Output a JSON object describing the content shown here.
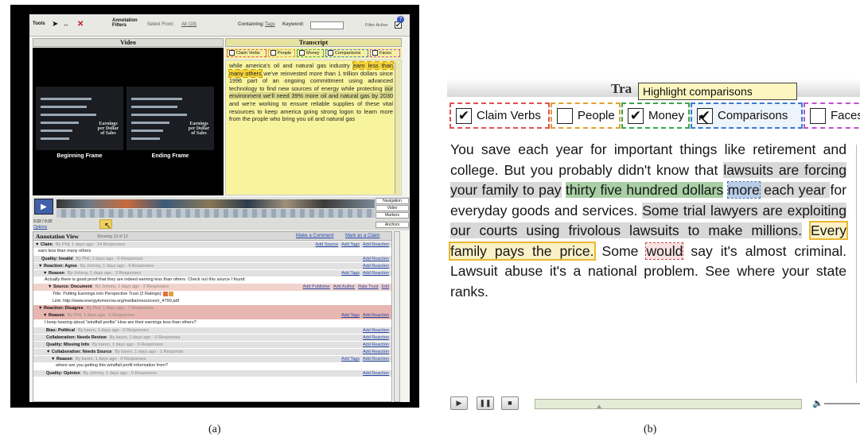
{
  "panel_a": {
    "toolbar": {
      "tools_label": "Tools",
      "annotation_filters_label": "Annotation Filters",
      "select_from_label": "Select From:",
      "select_from_value": "All (19)",
      "containing_label": "Containing:",
      "containing_value": "Tags",
      "keyword_label": "Keyword:",
      "keyword_value": "",
      "filter_active_label": "Filter Active",
      "filter_active_checked": "✔"
    },
    "video": {
      "title": "Video",
      "beginning_frame_label": "Beginning Frame",
      "ending_frame_label": "Ending Frame",
      "frame_overlay_text": "Earnings per Dollar of Sales"
    },
    "transcript": {
      "title": "Transcript",
      "categories": [
        "Claim Verbs",
        "People",
        "Money",
        "Comparisons",
        "Faces"
      ],
      "text_pre": "while america's oil and natural gas industry ",
      "text_hl1": "earn less than many others",
      "text_mid": " we've reinvested more than 1 trillion dollars since 1996 part of an ongoing committment using advanced technology to find new sources of energy while protecting ",
      "text_hl2": "our environment we'll need 39% more oil and natural gas by 2030",
      "text_post": " and we're working to ensure reliable supplies of these vital resources to keep america going strong logon to learn more from the prople who bring you oil and natural gas"
    },
    "timeline": {
      "time": "0:32 / 0:32",
      "options": "Options",
      "navigation": "Navigation",
      "video": "Video",
      "markers": "Markers",
      "anchors": "Anchors"
    },
    "annotation_view": {
      "title": "Annotation View",
      "showing": "Showing 13 of 13",
      "make_comment": "Make a Comment",
      "mark_claim": "Mark as a Claim",
      "rows": [
        {
          "label": "▼ Claim",
          "by": "By Phil, 1 days ago · 14 Responses",
          "acts": [
            "Add Source",
            "Add Tags",
            "Add Reaction"
          ],
          "style": "hdr",
          "indent": 2
        },
        {
          "label": "",
          "by": "",
          "body": "earn less than many others",
          "acts": [],
          "style": "body",
          "indent": 6
        },
        {
          "label": "Quality: Invalid",
          "by": "By Phil, 1 days ago · 0 Responses",
          "acts": [
            "Add Reaction"
          ],
          "style": "hdr",
          "indent": 10
        },
        {
          "label": "▼ Reaction: Agree",
          "by": "By Johnny, 1 days ago · 4 Responses",
          "acts": [
            "Add Reaction"
          ],
          "style": "hdr",
          "indent": 6
        },
        {
          "label": "▼ Reason",
          "by": "By Johnny, 1 days ago · 3 Responses",
          "acts": [
            "Add Tags",
            "Add Reaction"
          ],
          "style": "hdr",
          "indent": 12
        },
        {
          "label": "",
          "by": "",
          "body": "Actually there is good proof that they are indeed earning less than others. Check out this source I found:",
          "acts": [],
          "style": "body",
          "indent": 14
        },
        {
          "label": "▼ Source: Document",
          "by": "By Johnny, 1 days ago · 2 Responses",
          "acts": [
            "Add Publisher",
            "Add Author",
            "Rate Trust",
            "Edit"
          ],
          "style": "pink",
          "indent": 18
        },
        {
          "label": "",
          "by": "",
          "body": "Title:     Putting Earnings into Perspective                                                                        Trust (2 Ratings):",
          "acts": [],
          "style": "body",
          "indent": 24
        },
        {
          "label": "",
          "by": "",
          "body": "Link:     http://www.energytomorrow.org/media/resources/r_4790.pdf",
          "acts": [],
          "style": "body",
          "indent": 24
        },
        {
          "label": "▼ Reaction: Disagree",
          "by": "By Phil, 1 days ago · 7 Responses",
          "acts": [],
          "style": "red",
          "indent": 6
        },
        {
          "label": "▼ Reason",
          "by": "By Phil, 1 days ago · 6 Responses",
          "acts": [
            "Add Tags",
            "Add Reaction"
          ],
          "style": "red",
          "indent": 12
        },
        {
          "label": "",
          "by": "",
          "body": "I keep hearing about \"windfall profits\" How are their earnings less than others?",
          "acts": [],
          "style": "body",
          "indent": 14
        },
        {
          "label": "Bias: Political",
          "by": "By karen, 1 days ago · 0 Responses",
          "acts": [
            "Add Reaction"
          ],
          "style": "hdr",
          "indent": 16
        },
        {
          "label": "Collaboration: Needs Review",
          "by": "By karen, 1 days ago · 0 Responses",
          "acts": [
            "Add Reaction"
          ],
          "style": "hdr",
          "indent": 16
        },
        {
          "label": "Quality: Missing Info",
          "by": "By karen, 1 days ago · 0 Responses",
          "acts": [
            "Add Reaction"
          ],
          "style": "hdr",
          "indent": 16
        },
        {
          "label": "▼ Collaboration: Needs Source",
          "by": "By karen, 1 days ago · 1 Response",
          "acts": [
            "Add Reaction"
          ],
          "style": "hdr",
          "indent": 16
        },
        {
          "label": "▼ Reason",
          "by": "By karen, 1 days ago · 0 Responses",
          "acts": [
            "Add Tags",
            "Add Reaction"
          ],
          "style": "hdr",
          "indent": 22
        },
        {
          "label": "",
          "by": "",
          "body": "where are you getting this windfall profit information from?",
          "acts": [],
          "style": "body",
          "indent": 28
        },
        {
          "label": "Quality: Opinion",
          "by": "By Johnny, 1 days ago · 0 Responses",
          "acts": [
            "Add Reaction"
          ],
          "style": "hdr",
          "indent": 16
        }
      ]
    }
  },
  "panel_b": {
    "title_partial": "Tra",
    "tooltip": "Highlight comparisons",
    "categories": [
      {
        "label": "Claim Verbs",
        "checked": "✔",
        "color": "#e05050"
      },
      {
        "label": "People",
        "checked": "",
        "color": "#e0a030"
      },
      {
        "label": "Money",
        "checked": "✔",
        "color": "#3aa54a"
      },
      {
        "label": "Comparisons",
        "checked": "✔",
        "color": "#3a7ad0"
      },
      {
        "label": "Faces",
        "checked": "",
        "color": "#c050d0"
      }
    ],
    "text": {
      "s1": "You save each year for important things like retirement and college. But you probably didn't know that ",
      "grey1": "lawsuits are forcing your family to pay",
      "green1": "thirty five hundred dollars",
      "blue1": "more",
      "s2": " each year ",
      "s3": "for everyday goods and services. ",
      "grey2": "Some trial lawyers are exploiting our courts using frivolous lawsuits to make millions.",
      "s4": " ",
      "yellow1": "Every family pays the price.",
      "s5": " Some ",
      "red1": "would",
      "s6": " say it's almost criminal. Lawsuit abuse it's a national problem. See where your state ranks."
    }
  },
  "captions": {
    "a": "(a)",
    "b": "(b)"
  }
}
